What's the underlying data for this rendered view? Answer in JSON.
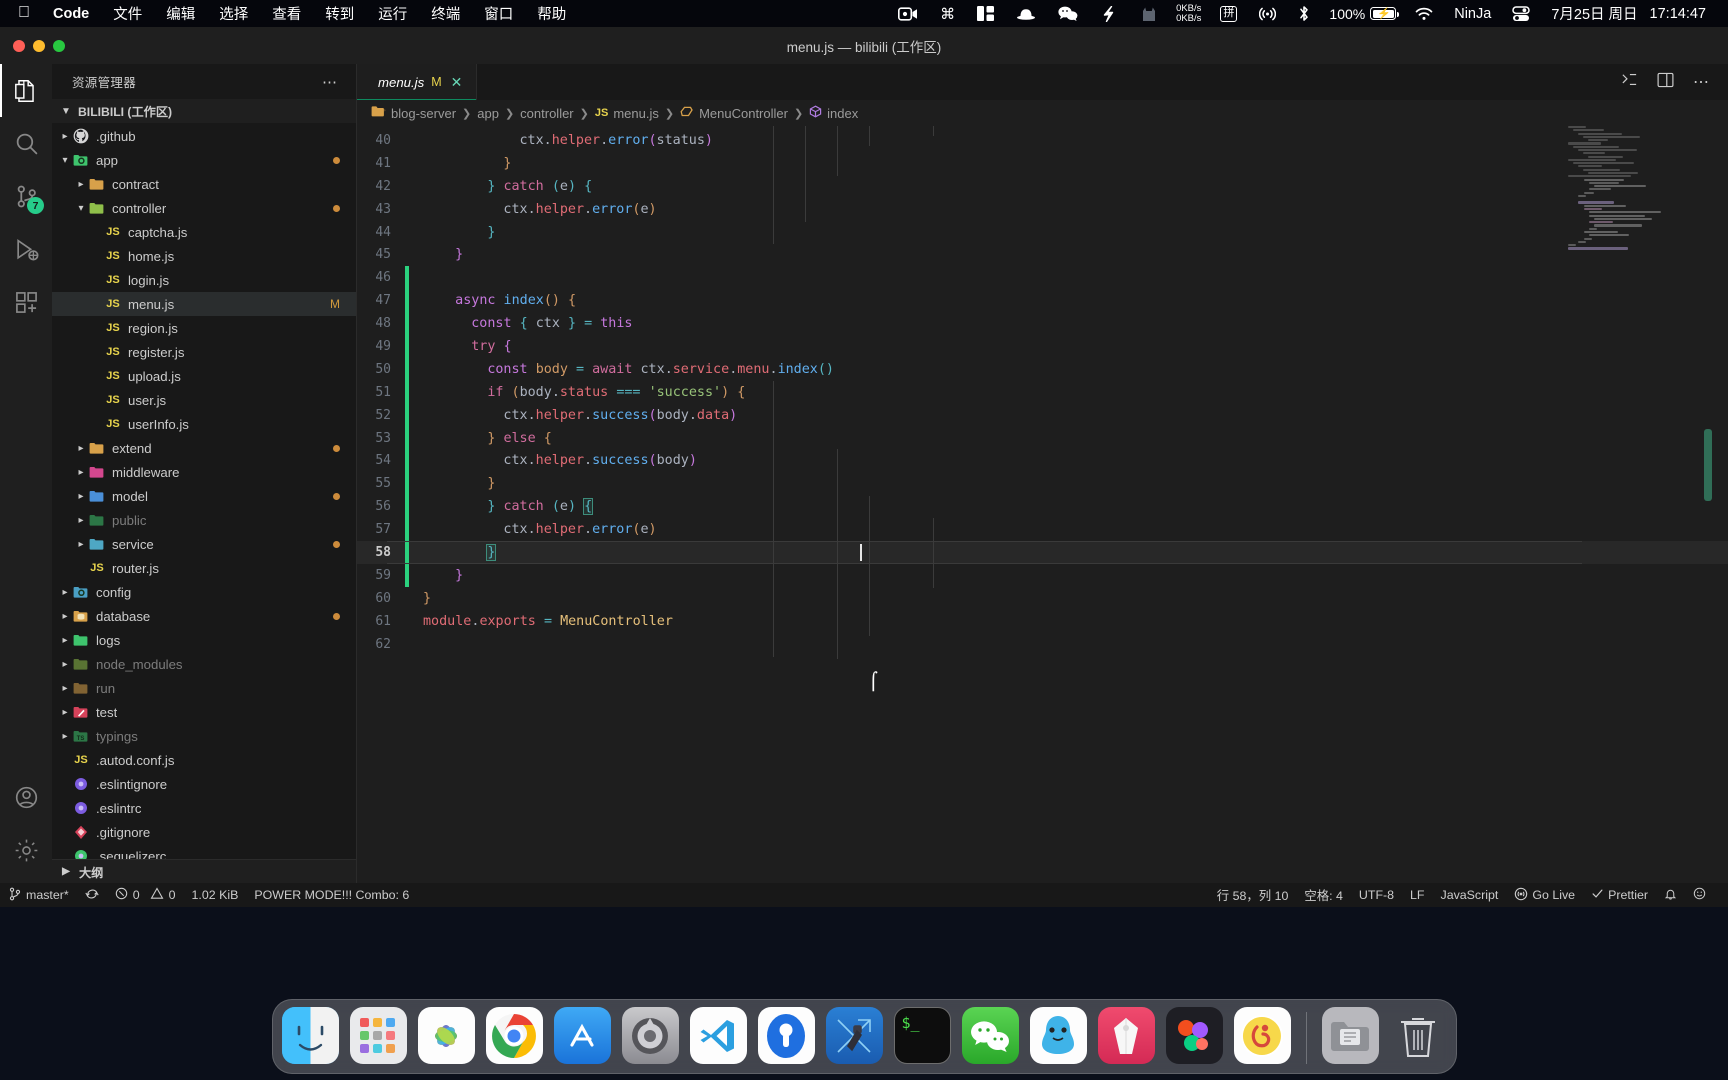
{
  "menubar": {
    "apple_icon": "apple-logo",
    "items": [
      {
        "label": "Code",
        "bold": true
      },
      {
        "label": "文件",
        "bold": false
      },
      {
        "label": "编辑",
        "bold": false
      },
      {
        "label": "选择",
        "bold": false
      },
      {
        "label": "查看",
        "bold": false
      },
      {
        "label": "转到",
        "bold": false
      },
      {
        "label": "运行",
        "bold": false
      },
      {
        "label": "终端",
        "bold": false
      },
      {
        "label": "窗口",
        "bold": false
      },
      {
        "label": "帮助",
        "bold": false
      }
    ],
    "status_icons": [
      "screen-record-icon",
      "command-key-icon",
      "window-layout-icon",
      "bowler-hat-icon",
      "wechat-icon",
      "lightning-icon",
      "cat-icon"
    ],
    "network_up": "0KB/s",
    "network_down": "0KB/s",
    "input_method": "拼",
    "airplay_icon": "airplay-icon",
    "bluetooth_icon": "bluetooth-icon",
    "battery_percent": "100%",
    "battery_charging": true,
    "wifi_icon": "wifi-icon",
    "user": "NinJa",
    "control_center_icon": "control-center-icon",
    "date": "7月25日 周日",
    "time": "17:14:47"
  },
  "window": {
    "title": "menu.js — bilibili (工作区)"
  },
  "activitybar": {
    "items": [
      {
        "name": "explorer",
        "icon": "files-icon",
        "active": true,
        "badge": ""
      },
      {
        "name": "search",
        "icon": "search-icon",
        "active": false,
        "badge": ""
      },
      {
        "name": "source-control",
        "icon": "source-control-icon",
        "active": false,
        "badge": "7"
      },
      {
        "name": "run-debug",
        "icon": "run-debug-icon",
        "active": false,
        "badge": ""
      },
      {
        "name": "extensions",
        "icon": "extensions-icon",
        "active": false,
        "badge": ""
      }
    ],
    "bottom": [
      {
        "name": "accounts",
        "icon": "account-icon"
      },
      {
        "name": "settings",
        "icon": "gear-icon"
      }
    ]
  },
  "sidebar": {
    "title": "资源管理器",
    "more_icon": "ellipsis-icon",
    "root": "BILIBILI (工作区)",
    "outline_label": "大纲",
    "tree": [
      {
        "label": ".github",
        "indent": 1,
        "type": "folder",
        "chev": "collapsed",
        "color": "#c9c9c9",
        "glyph": "github",
        "dim": false,
        "modified": false,
        "sel": false
      },
      {
        "label": "app",
        "indent": 1,
        "type": "folder",
        "chev": "expanded",
        "color": "#3ec46d",
        "glyph": "gear",
        "dim": false,
        "modified": true,
        "sel": false
      },
      {
        "label": "contract",
        "indent": 2,
        "type": "folder",
        "chev": "collapsed",
        "color": "#d8a14a",
        "glyph": "plain",
        "dim": false,
        "modified": false,
        "sel": false
      },
      {
        "label": "controller",
        "indent": 2,
        "type": "folder",
        "chev": "expanded",
        "color": "#8fbf4a",
        "glyph": "plain",
        "dim": false,
        "modified": true,
        "sel": false
      },
      {
        "label": "captcha.js",
        "indent": 3,
        "type": "js",
        "chev": "none",
        "color": "",
        "glyph": "",
        "dim": false,
        "modified": false,
        "sel": false
      },
      {
        "label": "home.js",
        "indent": 3,
        "type": "js",
        "chev": "none",
        "color": "",
        "glyph": "",
        "dim": false,
        "modified": false,
        "sel": false
      },
      {
        "label": "login.js",
        "indent": 3,
        "type": "js",
        "chev": "none",
        "color": "",
        "glyph": "",
        "dim": false,
        "modified": false,
        "sel": false
      },
      {
        "label": "menu.js",
        "indent": 3,
        "type": "js",
        "chev": "none",
        "color": "",
        "glyph": "",
        "dim": false,
        "modified": false,
        "sel": true,
        "flag": "M"
      },
      {
        "label": "region.js",
        "indent": 3,
        "type": "js",
        "chev": "none",
        "color": "",
        "glyph": "",
        "dim": false,
        "modified": false,
        "sel": false
      },
      {
        "label": "register.js",
        "indent": 3,
        "type": "js",
        "chev": "none",
        "color": "",
        "glyph": "",
        "dim": false,
        "modified": false,
        "sel": false
      },
      {
        "label": "upload.js",
        "indent": 3,
        "type": "js",
        "chev": "none",
        "color": "",
        "glyph": "",
        "dim": false,
        "modified": false,
        "sel": false
      },
      {
        "label": "user.js",
        "indent": 3,
        "type": "js",
        "chev": "none",
        "color": "",
        "glyph": "",
        "dim": false,
        "modified": false,
        "sel": false
      },
      {
        "label": "userInfo.js",
        "indent": 3,
        "type": "js",
        "chev": "none",
        "color": "",
        "glyph": "",
        "dim": false,
        "modified": false,
        "sel": false
      },
      {
        "label": "extend",
        "indent": 2,
        "type": "folder",
        "chev": "collapsed",
        "color": "#d8a14a",
        "glyph": "plain",
        "dim": false,
        "modified": true,
        "sel": false
      },
      {
        "label": "middleware",
        "indent": 2,
        "type": "folder",
        "chev": "collapsed",
        "color": "#d3478e",
        "glyph": "plain",
        "dim": false,
        "modified": false,
        "sel": false
      },
      {
        "label": "model",
        "indent": 2,
        "type": "folder",
        "chev": "collapsed",
        "color": "#4a8fd8",
        "glyph": "plain",
        "dim": false,
        "modified": true,
        "sel": false
      },
      {
        "label": "public",
        "indent": 2,
        "type": "folder",
        "chev": "collapsed",
        "color": "#3ec46d",
        "glyph": "plain",
        "dim": true,
        "modified": false,
        "sel": false
      },
      {
        "label": "service",
        "indent": 2,
        "type": "folder",
        "chev": "collapsed",
        "color": "#4ea7c4",
        "glyph": "plain",
        "dim": false,
        "modified": true,
        "sel": false
      },
      {
        "label": "router.js",
        "indent": 2,
        "type": "js",
        "chev": "none",
        "color": "",
        "glyph": "",
        "dim": false,
        "modified": false,
        "sel": false
      },
      {
        "label": "config",
        "indent": 1,
        "type": "folder",
        "chev": "collapsed",
        "color": "#4a9fc4",
        "glyph": "gear",
        "dim": false,
        "modified": false,
        "sel": false
      },
      {
        "label": "database",
        "indent": 1,
        "type": "folder",
        "chev": "collapsed",
        "color": "#d8a14a",
        "glyph": "db",
        "dim": false,
        "modified": true,
        "sel": false
      },
      {
        "label": "logs",
        "indent": 1,
        "type": "folder",
        "chev": "collapsed",
        "color": "#3ec46d",
        "glyph": "plain",
        "dim": false,
        "modified": false,
        "sel": false
      },
      {
        "label": "node_modules",
        "indent": 1,
        "type": "folder",
        "chev": "collapsed",
        "color": "#8fbf4a",
        "glyph": "plain",
        "dim": true,
        "modified": false,
        "sel": false
      },
      {
        "label": "run",
        "indent": 1,
        "type": "folder",
        "chev": "collapsed",
        "color": "#d8a14a",
        "glyph": "plain",
        "dim": true,
        "modified": false,
        "sel": false
      },
      {
        "label": "test",
        "indent": 1,
        "type": "folder",
        "chev": "collapsed",
        "color": "#d6425a",
        "glyph": "flask",
        "dim": false,
        "modified": false,
        "sel": false
      },
      {
        "label": "typings",
        "indent": 1,
        "type": "folder",
        "chev": "collapsed",
        "color": "#3ec46d",
        "glyph": "ts",
        "dim": true,
        "modified": false,
        "sel": false
      },
      {
        "label": ".autod.conf.js",
        "indent": 1,
        "type": "js",
        "chev": "none",
        "color": "",
        "glyph": "",
        "dim": false,
        "modified": false,
        "sel": false
      },
      {
        "label": ".eslintignore",
        "indent": 1,
        "type": "dot",
        "chev": "none",
        "color": "#7c5ce0",
        "glyph": "circle",
        "dim": false,
        "modified": false,
        "sel": false
      },
      {
        "label": ".eslintrc",
        "indent": 1,
        "type": "dot",
        "chev": "none",
        "color": "#7c5ce0",
        "glyph": "circle",
        "dim": false,
        "modified": false,
        "sel": false
      },
      {
        "label": ".gitignore",
        "indent": 1,
        "type": "dot",
        "chev": "none",
        "color": "#d6425a",
        "glyph": "git",
        "dim": false,
        "modified": false,
        "sel": false
      },
      {
        "label": ".sequelizerc",
        "indent": 1,
        "type": "dot",
        "chev": "none",
        "color": "#3ec46d",
        "glyph": "circle",
        "dim": false,
        "modified": false,
        "sel": false
      }
    ]
  },
  "editor": {
    "tab": {
      "filename": "menu.js",
      "badge": "M",
      "icon": "js-icon",
      "close_icon": "close-icon"
    },
    "tab_actions": [
      "split-editor-icon",
      "layout-icon",
      "more-actions-icon"
    ],
    "breadcrumb": [
      {
        "label": "blog-server",
        "icon": "folder-icon"
      },
      {
        "label": "app",
        "icon": ""
      },
      {
        "label": "controller",
        "icon": ""
      },
      {
        "label": "menu.js",
        "icon": "js-icon"
      },
      {
        "label": "MenuController",
        "icon": "class-icon"
      },
      {
        "label": "index",
        "icon": "method-icon"
      }
    ],
    "first_line": 40,
    "lines": [
      {
        "n": 40,
        "git": false,
        "indent": 0
      },
      {
        "n": 41,
        "git": false,
        "indent": 0
      },
      {
        "n": 42,
        "git": false,
        "indent": 0
      },
      {
        "n": 43,
        "git": false,
        "indent": 0
      },
      {
        "n": 44,
        "git": false,
        "indent": 0
      },
      {
        "n": 45,
        "git": false,
        "indent": 0
      },
      {
        "n": 46,
        "git": true,
        "indent": 0
      },
      {
        "n": 47,
        "git": true,
        "indent": 0
      },
      {
        "n": 48,
        "git": true,
        "indent": 0
      },
      {
        "n": 49,
        "git": true,
        "indent": 0
      },
      {
        "n": 50,
        "git": true,
        "indent": 0
      },
      {
        "n": 51,
        "git": true,
        "indent": 0
      },
      {
        "n": 52,
        "git": true,
        "indent": 0
      },
      {
        "n": 53,
        "git": true,
        "indent": 0
      },
      {
        "n": 54,
        "git": true,
        "indent": 0
      },
      {
        "n": 55,
        "git": true,
        "indent": 0
      },
      {
        "n": 56,
        "git": true,
        "indent": 0
      },
      {
        "n": 57,
        "git": true,
        "indent": 0
      },
      {
        "n": 58,
        "git": true,
        "indent": 0
      },
      {
        "n": 59,
        "git": true,
        "indent": 0
      },
      {
        "n": 60,
        "git": false,
        "indent": 0
      },
      {
        "n": 61,
        "git": false,
        "indent": 0
      },
      {
        "n": 62,
        "git": false,
        "indent": 0
      }
    ],
    "source_lines": [
      "            ctx.helper.error(status)",
      "        }",
      "    } catch (e) {",
      "        ctx.helper.error(e)",
      "    }",
      "  }",
      "",
      "  async index() {",
      "    const { ctx } = this",
      "    try {",
      "      const body = await ctx.service.menu.index()",
      "      if (body.status === 'success') {",
      "        ctx.helper.success(body.data)",
      "      } else {",
      "        ctx.helper.success(body)",
      "      }",
      "    } catch (e) {",
      "        ctx.helper.error(e)",
      "    }",
      "  }",
      "}",
      "module.exports = MenuController",
      ""
    ],
    "current_line": 58
  },
  "statusbar": {
    "left": [
      {
        "name": "branch",
        "icon": "source-control-icon",
        "label": "master*"
      },
      {
        "name": "sync",
        "icon": "sync-icon",
        "label": ""
      },
      {
        "name": "problems",
        "icon": "error-warning-icon",
        "label": "0  0"
      },
      {
        "name": "filesize",
        "icon": "",
        "label": "1.02 KiB"
      },
      {
        "name": "power-mode",
        "icon": "",
        "label": "POWER MODE!!! Combo: 6"
      }
    ],
    "errors": "0",
    "warnings": "0",
    "right": [
      {
        "name": "cursor-position",
        "icon": "",
        "label": "行 58，列 10"
      },
      {
        "name": "indentation",
        "icon": "",
        "label": "空格: 4"
      },
      {
        "name": "encoding",
        "icon": "",
        "label": "UTF-8"
      },
      {
        "name": "eol",
        "icon": "",
        "label": "LF"
      },
      {
        "name": "language-mode",
        "icon": "",
        "label": "JavaScript"
      },
      {
        "name": "go-live",
        "icon": "broadcast-icon",
        "label": "Go Live"
      },
      {
        "name": "prettier",
        "icon": "check-icon",
        "label": "Prettier"
      },
      {
        "name": "notifications",
        "icon": "bell-icon",
        "label": ""
      },
      {
        "name": "feedback",
        "icon": "smiley-icon",
        "label": ""
      }
    ]
  },
  "dock": {
    "items": [
      {
        "name": "finder",
        "running": true
      },
      {
        "name": "launchpad",
        "running": false
      },
      {
        "name": "photos",
        "running": false
      },
      {
        "name": "chrome",
        "running": true
      },
      {
        "name": "app-store",
        "running": false
      },
      {
        "name": "system-preferences",
        "running": false
      },
      {
        "name": "visual-studio-code",
        "running": true
      },
      {
        "name": "sourcetree",
        "running": false
      },
      {
        "name": "xcode",
        "running": false
      },
      {
        "name": "terminal",
        "running": true
      },
      {
        "name": "wechat",
        "running": false
      },
      {
        "name": "qq",
        "running": false
      },
      {
        "name": "sketch",
        "running": false
      },
      {
        "name": "figma",
        "running": false
      },
      {
        "name": "netease-music",
        "running": false
      },
      {
        "name": "downloads-folder",
        "running": false
      },
      {
        "name": "trash",
        "running": false
      }
    ]
  }
}
